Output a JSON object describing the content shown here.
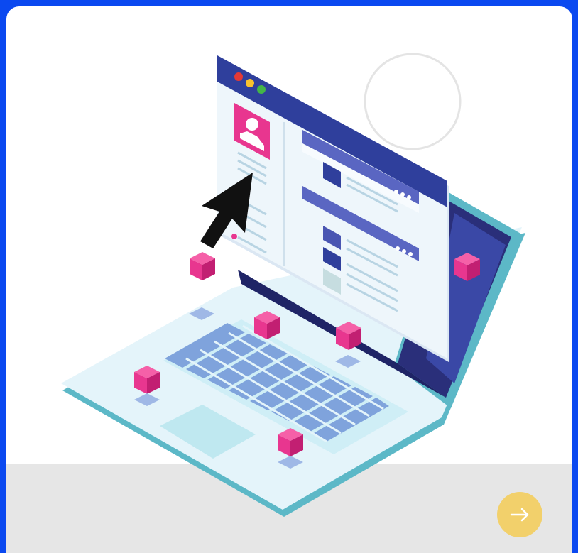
{
  "hero": {
    "illustration": "laptop-with-profile-window",
    "icons": [
      "user-avatar-icon",
      "mouse-cursor-icon",
      "window-controls-icon",
      "more-dots-icon",
      "cube-icon"
    ]
  },
  "next_button": {
    "icon": "arrow-right-icon",
    "color": "#f2d06b"
  },
  "colors": {
    "background": "#0b49f0",
    "card": "#ffffff",
    "footer": "#e6e6e6",
    "accent_pink": "#e8368f",
    "window_header": "#2f3f9c"
  }
}
